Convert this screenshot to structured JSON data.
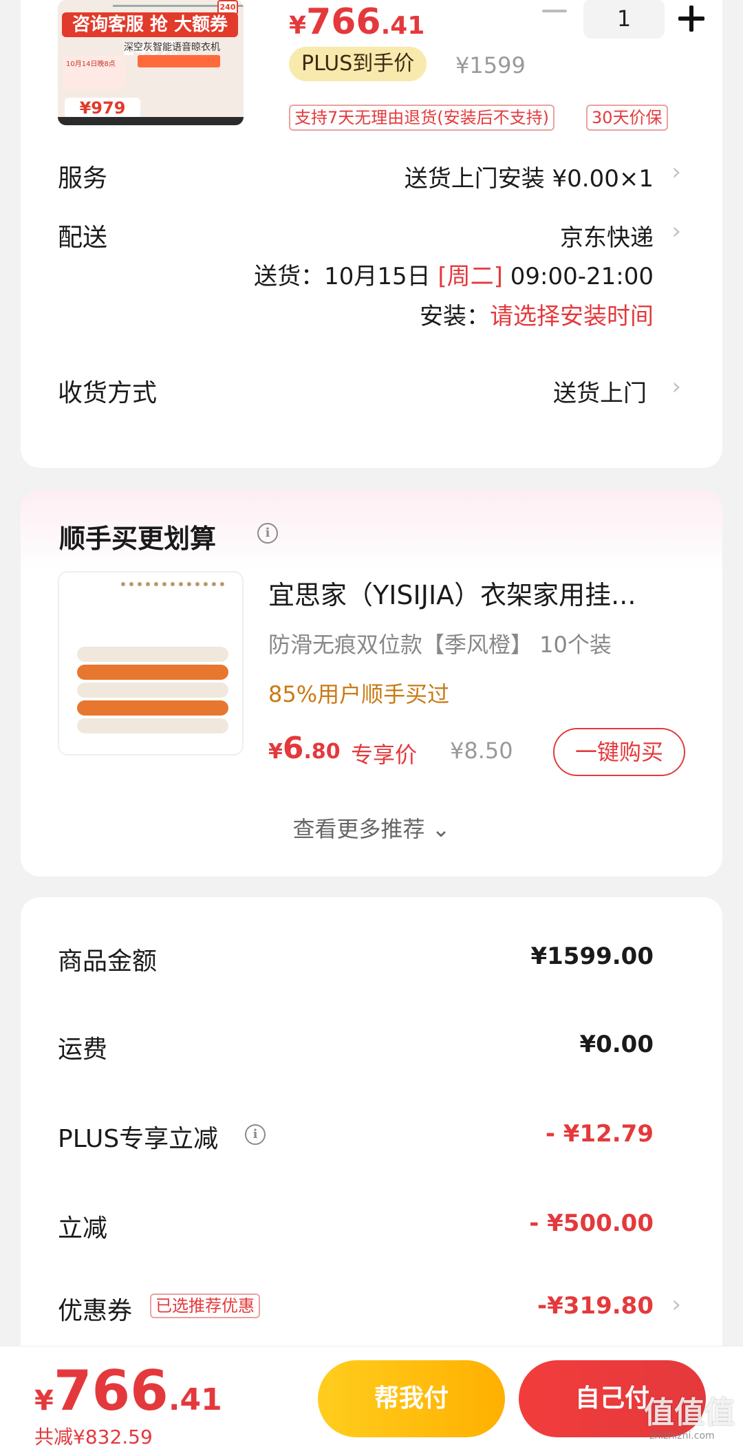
{
  "product": {
    "thumb_banner": "咨询客服 抢 大额券240元",
    "thumb_sub": "深空灰智能语音晾衣机",
    "thumb_promo": "10月14日晚8点",
    "thumb_badge": "240",
    "thumb_price": "¥979",
    "price_yen": "¥",
    "price_int": "766",
    "price_dec": ".41",
    "quantity": "1",
    "plus_label": "PLUS到手价",
    "original_price": "¥1599",
    "service_tags": [
      "支持7天无理由退货(安装后不支持)",
      "30天价保"
    ]
  },
  "rows": {
    "service_label": "服务",
    "service_value": "送货上门安装  ¥0.00×1",
    "delivery_label": "配送",
    "delivery_value": "京东快递",
    "delivery_time_prefix": "送货：10月15日",
    "delivery_day": "[周二]",
    "delivery_time": "09:00-21:00",
    "install_prefix": "安装：",
    "install_value": "请选择安装时间",
    "receive_label": "收货方式",
    "receive_value": "送货上门"
  },
  "recommend": {
    "title": "顺手买更划算",
    "info_icon": "i",
    "item_title": "宜思家（YISIJIA）衣架家用挂...",
    "item_spec": "防滑无痕双位款【季风橙】  10个装",
    "item_buyers": "85%用户顺手买过",
    "price_yen": "¥",
    "price_int": "6",
    "price_dec": ".80",
    "exclusive_label": "专享价",
    "orig_price": "¥8.50",
    "buy_button": "一键购买",
    "more": "查看更多推荐 ⌄"
  },
  "summary": {
    "items": [
      {
        "label": "商品金额",
        "value": "¥1599.00"
      },
      {
        "label": "运费",
        "value": "¥0.00"
      },
      {
        "label": "PLUS专享立减",
        "value": "- ¥12.79"
      },
      {
        "label": "立减",
        "value": "- ¥500.00"
      },
      {
        "label": "优惠券",
        "value": "-¥319.80"
      }
    ],
    "coupon_tag": "已选推荐优惠"
  },
  "bottom": {
    "price_yen": "¥",
    "price_int": "766",
    "price_dec": ".41",
    "saved": "共减¥832.59",
    "help_pay": "帮我付",
    "self_pay": "自己付",
    "watermark": "值值值",
    "watermark_sub": "zhizhizhi.com"
  },
  "colors": {
    "accent_red": "#e4393c",
    "plus_gold": "#f8e9ad",
    "help_pay_yellow": "#ffb000"
  }
}
